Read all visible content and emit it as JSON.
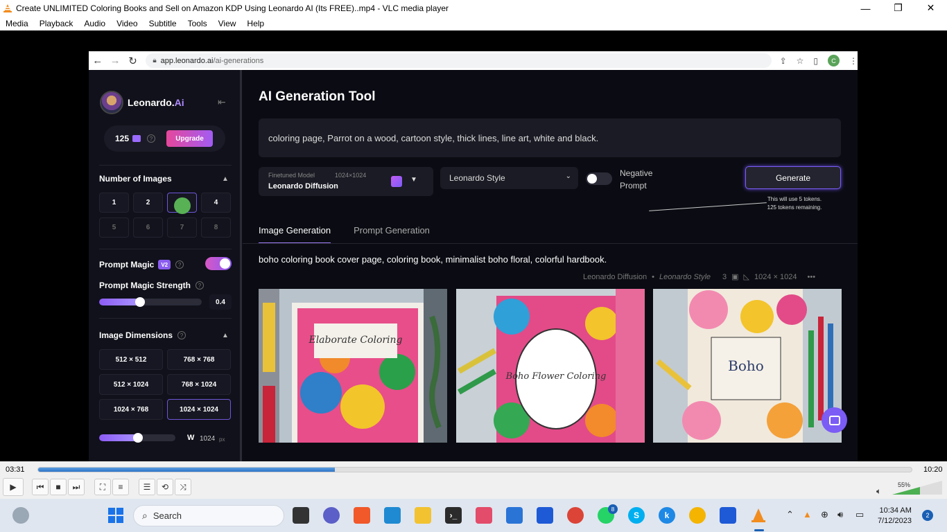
{
  "window": {
    "title": "Create UNLIMITED Coloring Books and Sell on Amazon KDP Using Leonardo AI (Its FREE)..mp4 - VLC media player",
    "controls": [
      "—",
      "❐",
      "✕"
    ]
  },
  "menu": [
    "Media",
    "Playback",
    "Audio",
    "Video",
    "Subtitle",
    "Tools",
    "View",
    "Help"
  ],
  "browser": {
    "url_host": "app.leonardo.ai",
    "url_path": "/ai-generations",
    "profile_initial": "C"
  },
  "sidebar": {
    "brand": "Leonardo.",
    "brand_ai": "Ai",
    "tokens": "125",
    "upgrade_label": "Upgrade",
    "num_images_title": "Number of Images",
    "num_options": [
      "1",
      "2",
      "3",
      "4",
      "5",
      "6",
      "7",
      "8"
    ],
    "num_selected": 3,
    "prompt_magic_title": "Prompt Magic",
    "prompt_magic_version": "V2",
    "prompt_magic_enabled": true,
    "strength_title": "Prompt Magic Strength",
    "strength_value": "0.4",
    "strength_fraction": 0.4,
    "dimensions_title": "Image Dimensions",
    "dimensions": [
      "512 × 512",
      "768 × 768",
      "512 × 1024",
      "768 × 1024",
      "1024 × 768",
      "1024 × 1024"
    ],
    "dimension_selected": "1024 × 1024",
    "width_label": "W",
    "width_value": "1024",
    "width_unit": "px"
  },
  "main": {
    "title": "AI Generation Tool",
    "prompt": "coloring page, Parrot on a wood, cartoon style, thick lines, line art, white and black.",
    "model_label": "Finetuned Model",
    "model_res": "1024×1024",
    "model_name": "Leonardo Diffusion",
    "style": "Leonardo Style",
    "negative_prompt_label": "Negative Prompt",
    "negative_prompt_enabled": false,
    "generate_label": "Generate",
    "token_note_1": "This will use 5 tokens.",
    "token_note_2": "125 tokens remaining.",
    "tabs": [
      "Image Generation",
      "Prompt Generation"
    ],
    "active_tab": "Image Generation",
    "generation_prompt": "boho coloring book cover page, coloring book, minimalist boho floral, colorful hardbook.",
    "meta_model": "Leonardo Diffusion",
    "meta_style": "Leonardo Style",
    "meta_count": "3",
    "meta_res": "1024 × 1024",
    "meta_more": "•••",
    "images": [
      {
        "name": "book-cover-1",
        "text": "Elaborate Coloring"
      },
      {
        "name": "book-cover-2",
        "text": "Boho Flower Coloring"
      },
      {
        "name": "book-cover-3",
        "text": "Boho"
      }
    ]
  },
  "player": {
    "elapsed": "03:31",
    "total": "10:20",
    "progress_fraction": 0.34,
    "volume": "55%",
    "volume_fraction": 0.55
  },
  "taskbar": {
    "search_placeholder": "Search",
    "time": "10:34 AM",
    "date": "7/12/2023",
    "notifications": "2",
    "whatsapp_badge": "8"
  },
  "colors": {
    "accent": "#7a5cf5",
    "upgrade": "#e5479b",
    "page_bg": "#0b0c13",
    "seek": "#2e75c8"
  }
}
